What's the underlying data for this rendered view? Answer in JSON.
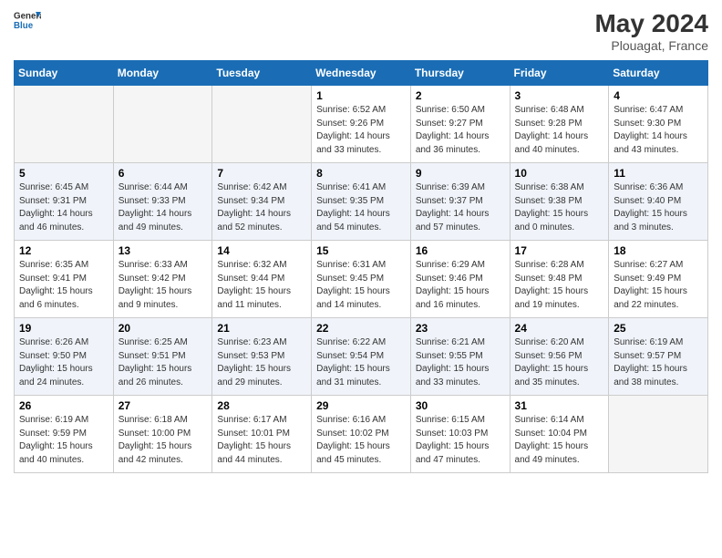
{
  "header": {
    "logo_general": "General",
    "logo_blue": "Blue",
    "month_year": "May 2024",
    "location": "Plouagat, France"
  },
  "days_of_week": [
    "Sunday",
    "Monday",
    "Tuesday",
    "Wednesday",
    "Thursday",
    "Friday",
    "Saturday"
  ],
  "weeks": [
    [
      {
        "day": "",
        "info": ""
      },
      {
        "day": "",
        "info": ""
      },
      {
        "day": "",
        "info": ""
      },
      {
        "day": "1",
        "info": "Sunrise: 6:52 AM\nSunset: 9:26 PM\nDaylight: 14 hours and 33 minutes."
      },
      {
        "day": "2",
        "info": "Sunrise: 6:50 AM\nSunset: 9:27 PM\nDaylight: 14 hours and 36 minutes."
      },
      {
        "day": "3",
        "info": "Sunrise: 6:48 AM\nSunset: 9:28 PM\nDaylight: 14 hours and 40 minutes."
      },
      {
        "day": "4",
        "info": "Sunrise: 6:47 AM\nSunset: 9:30 PM\nDaylight: 14 hours and 43 minutes."
      }
    ],
    [
      {
        "day": "5",
        "info": "Sunrise: 6:45 AM\nSunset: 9:31 PM\nDaylight: 14 hours and 46 minutes."
      },
      {
        "day": "6",
        "info": "Sunrise: 6:44 AM\nSunset: 9:33 PM\nDaylight: 14 hours and 49 minutes."
      },
      {
        "day": "7",
        "info": "Sunrise: 6:42 AM\nSunset: 9:34 PM\nDaylight: 14 hours and 52 minutes."
      },
      {
        "day": "8",
        "info": "Sunrise: 6:41 AM\nSunset: 9:35 PM\nDaylight: 14 hours and 54 minutes."
      },
      {
        "day": "9",
        "info": "Sunrise: 6:39 AM\nSunset: 9:37 PM\nDaylight: 14 hours and 57 minutes."
      },
      {
        "day": "10",
        "info": "Sunrise: 6:38 AM\nSunset: 9:38 PM\nDaylight: 15 hours and 0 minutes."
      },
      {
        "day": "11",
        "info": "Sunrise: 6:36 AM\nSunset: 9:40 PM\nDaylight: 15 hours and 3 minutes."
      }
    ],
    [
      {
        "day": "12",
        "info": "Sunrise: 6:35 AM\nSunset: 9:41 PM\nDaylight: 15 hours and 6 minutes."
      },
      {
        "day": "13",
        "info": "Sunrise: 6:33 AM\nSunset: 9:42 PM\nDaylight: 15 hours and 9 minutes."
      },
      {
        "day": "14",
        "info": "Sunrise: 6:32 AM\nSunset: 9:44 PM\nDaylight: 15 hours and 11 minutes."
      },
      {
        "day": "15",
        "info": "Sunrise: 6:31 AM\nSunset: 9:45 PM\nDaylight: 15 hours and 14 minutes."
      },
      {
        "day": "16",
        "info": "Sunrise: 6:29 AM\nSunset: 9:46 PM\nDaylight: 15 hours and 16 minutes."
      },
      {
        "day": "17",
        "info": "Sunrise: 6:28 AM\nSunset: 9:48 PM\nDaylight: 15 hours and 19 minutes."
      },
      {
        "day": "18",
        "info": "Sunrise: 6:27 AM\nSunset: 9:49 PM\nDaylight: 15 hours and 22 minutes."
      }
    ],
    [
      {
        "day": "19",
        "info": "Sunrise: 6:26 AM\nSunset: 9:50 PM\nDaylight: 15 hours and 24 minutes."
      },
      {
        "day": "20",
        "info": "Sunrise: 6:25 AM\nSunset: 9:51 PM\nDaylight: 15 hours and 26 minutes."
      },
      {
        "day": "21",
        "info": "Sunrise: 6:23 AM\nSunset: 9:53 PM\nDaylight: 15 hours and 29 minutes."
      },
      {
        "day": "22",
        "info": "Sunrise: 6:22 AM\nSunset: 9:54 PM\nDaylight: 15 hours and 31 minutes."
      },
      {
        "day": "23",
        "info": "Sunrise: 6:21 AM\nSunset: 9:55 PM\nDaylight: 15 hours and 33 minutes."
      },
      {
        "day": "24",
        "info": "Sunrise: 6:20 AM\nSunset: 9:56 PM\nDaylight: 15 hours and 35 minutes."
      },
      {
        "day": "25",
        "info": "Sunrise: 6:19 AM\nSunset: 9:57 PM\nDaylight: 15 hours and 38 minutes."
      }
    ],
    [
      {
        "day": "26",
        "info": "Sunrise: 6:19 AM\nSunset: 9:59 PM\nDaylight: 15 hours and 40 minutes."
      },
      {
        "day": "27",
        "info": "Sunrise: 6:18 AM\nSunset: 10:00 PM\nDaylight: 15 hours and 42 minutes."
      },
      {
        "day": "28",
        "info": "Sunrise: 6:17 AM\nSunset: 10:01 PM\nDaylight: 15 hours and 44 minutes."
      },
      {
        "day": "29",
        "info": "Sunrise: 6:16 AM\nSunset: 10:02 PM\nDaylight: 15 hours and 45 minutes."
      },
      {
        "day": "30",
        "info": "Sunrise: 6:15 AM\nSunset: 10:03 PM\nDaylight: 15 hours and 47 minutes."
      },
      {
        "day": "31",
        "info": "Sunrise: 6:14 AM\nSunset: 10:04 PM\nDaylight: 15 hours and 49 minutes."
      },
      {
        "day": "",
        "info": ""
      }
    ]
  ]
}
